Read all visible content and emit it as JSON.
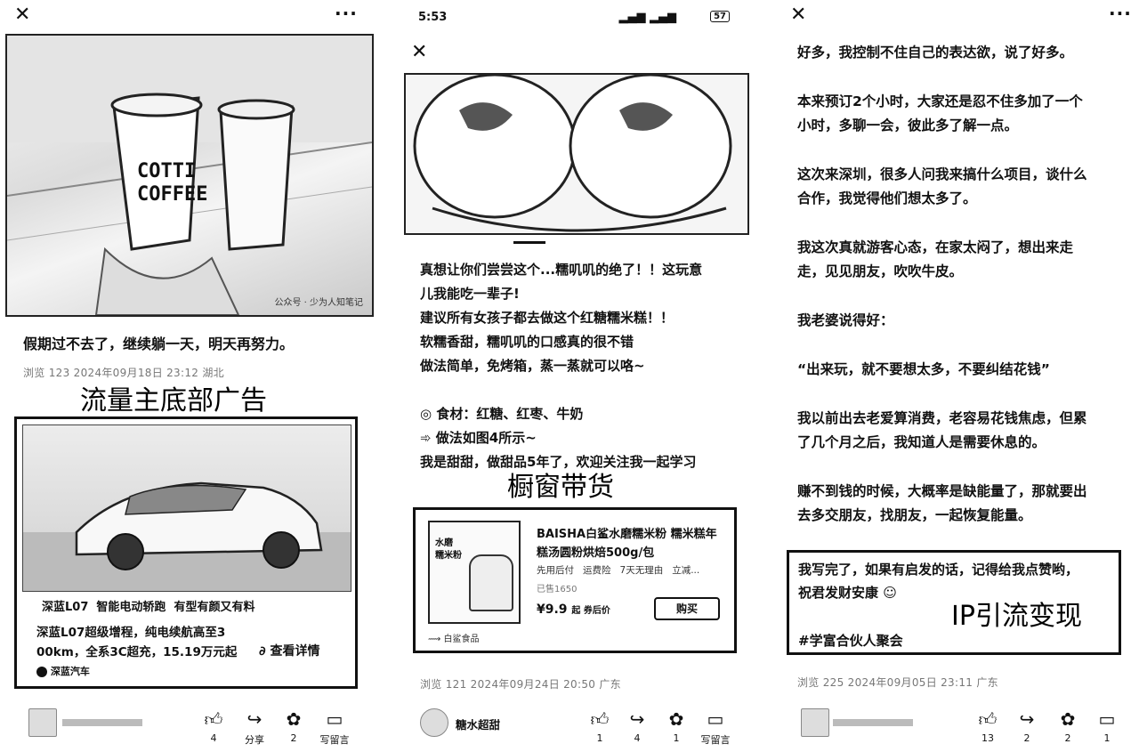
{
  "panel1": {
    "photo_watermark": "公众号 · 少为人知笔记",
    "cup_text_1": "COTTI",
    "cup_text_2": "COFFEE",
    "post_title": "假期过不去了，继续躺一天，明天再努力。",
    "meta": "浏览 123   2024年09月18日 23:12   湖北",
    "annotation": "流量主底部广告",
    "ad": {
      "tagline": "深蓝L07  智能电动轿跑  有型有颜又有料",
      "desc_line1": "深蓝L07超级增程，纯电续航高至3",
      "desc_line2": "00km，全系3C超充，15.19万元起",
      "detail_link": "查看详情",
      "brand": "深蓝汽车"
    },
    "actions": [
      {
        "icon": "like-icon",
        "count": "4"
      },
      {
        "icon": "share-icon",
        "count": "分享"
      },
      {
        "icon": "recommend-icon",
        "count": "2"
      },
      {
        "icon": "comment-icon",
        "count": "写留言"
      }
    ]
  },
  "panel2": {
    "status_time": "5:53",
    "battery": "57",
    "post_lines": [
      "真想让你们尝尝这个...糯叽叽的绝了！！这玩意",
      "儿我能吃一辈子!",
      "建议所有女孩子都去做这个红糖糯米糕！！",
      "软糯香甜，糯叽叽的口感真的很不错",
      "做法简单，免烤箱，蒸一蒸就可以咯~",
      "",
      "食材：红糖、红枣、牛奶",
      "做法如图4所示~",
      "我是甜甜，做甜品5年了，欢迎关注我一起学习"
    ],
    "annotation": "橱窗带货",
    "product": {
      "title_line1": "BAISHA白鲨水磨糯米粉 糯米糕年",
      "title_line2": "糕汤圆粉烘焙500g/包",
      "tags": "先用后付   运费险   7天无理由   立减...",
      "sold": "已售1650",
      "price": "¥9.9",
      "price_suffix": "起 券后价",
      "buy_button": "购买",
      "shop": "白鲨食品",
      "thumb_text_1": "水磨",
      "thumb_text_2": "糯米粉"
    },
    "meta": "浏览 121   2024年09月24日 20:50   广东",
    "author": "糖水超甜",
    "actions": [
      {
        "icon": "like-icon",
        "count": "1"
      },
      {
        "icon": "share-icon",
        "count": "4"
      },
      {
        "icon": "recommend-icon",
        "count": "1"
      },
      {
        "icon": "comment-icon",
        "count": "写留言"
      }
    ]
  },
  "panel3": {
    "paragraphs": [
      [
        "好多，我控制不住自己的表达欲，说了好多。"
      ],
      [
        "本来预订2个小时，大家还是忍不住多加了一个",
        "小时，多聊一会，彼此多了解一点。"
      ],
      [
        "这次来深圳，很多人问我来搞什么项目，谈什么",
        "合作，我觉得他们想太多了。"
      ],
      [
        "我这次真就游客心态，在家太闷了，想出来走",
        "走，见见朋友，吹吹牛皮。"
      ],
      [
        "我老婆说得好："
      ],
      [
        "“出来玩，就不要想太多，不要纠结花钱”"
      ],
      [
        "我以前出去老爱算消费，老容易花钱焦虑，但累",
        "了几个月之后，我知道人是需要休息的。"
      ],
      [
        "赚不到钱的时候，大概率是缺能量了，那就要出",
        "去多交朋友，找朋友，一起恢复能量。"
      ]
    ],
    "box_line1": "我写完了，如果有启发的话，记得给我点赞哟，",
    "box_line2": "祝君发财安康",
    "box_tag": "#学富合伙人聚会",
    "annotation": "IP引流变现",
    "meta": "浏览 225   2024年09月05日 23:11   广东",
    "actions": [
      {
        "icon": "like-icon",
        "count": "13"
      },
      {
        "icon": "share-icon",
        "count": "2"
      },
      {
        "icon": "recommend-icon",
        "count": "2"
      },
      {
        "icon": "comment-icon",
        "count": "1"
      }
    ]
  }
}
